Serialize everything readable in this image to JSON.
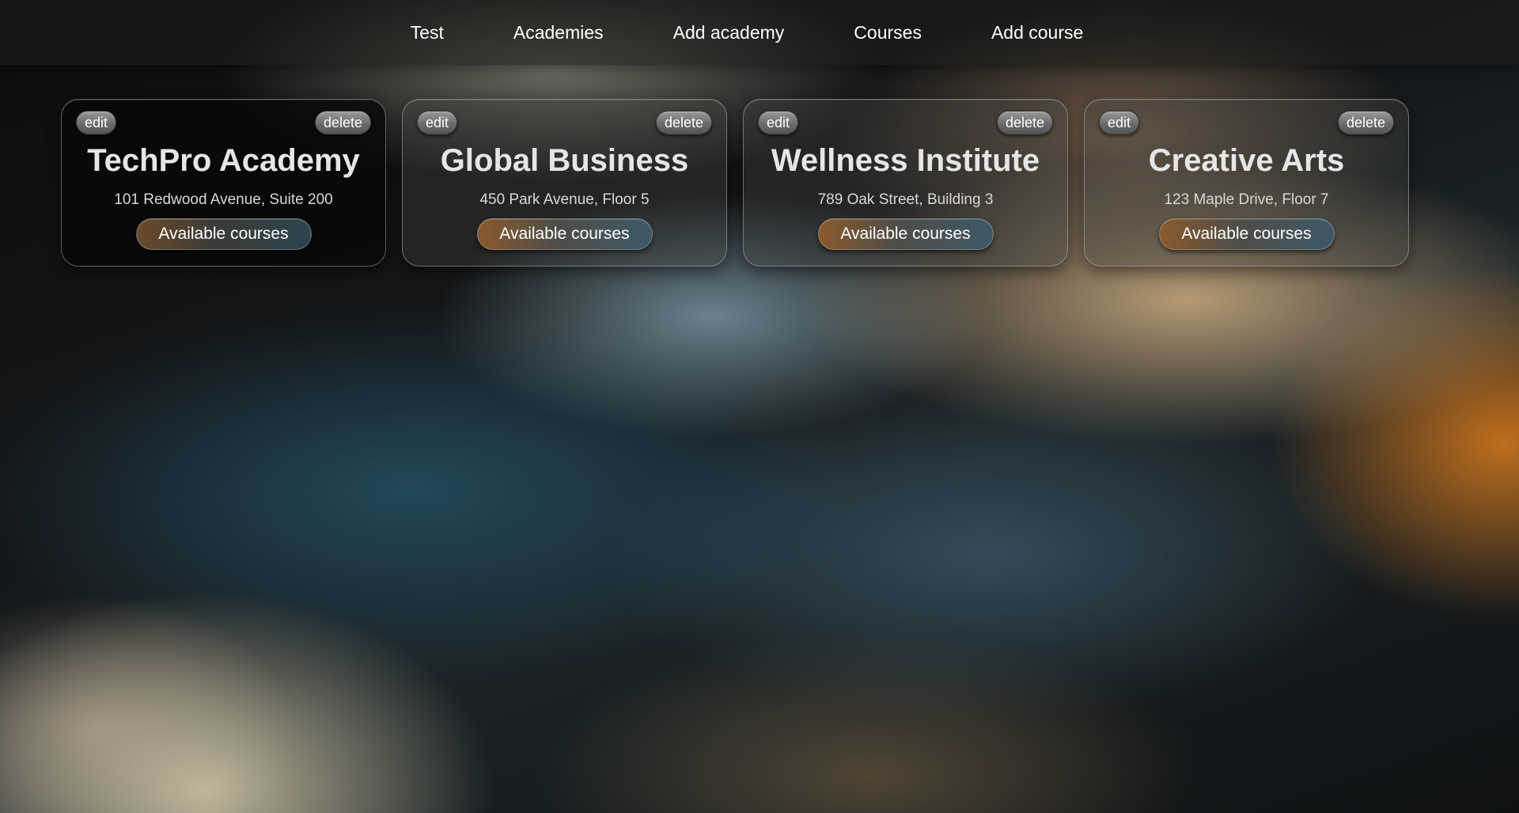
{
  "nav": {
    "items": [
      {
        "label": "Test"
      },
      {
        "label": "Academies"
      },
      {
        "label": "Add academy"
      },
      {
        "label": "Courses"
      },
      {
        "label": "Add course"
      }
    ]
  },
  "academies": [
    {
      "name": "TechPro Academy",
      "address": "101 Redwood Avenue, Suite 200",
      "edit_label": "edit",
      "delete_label": "delete",
      "courses_label": "Available courses"
    },
    {
      "name": "Global Business",
      "address": "450 Park Avenue, Floor 5",
      "edit_label": "edit",
      "delete_label": "delete",
      "courses_label": "Available courses"
    },
    {
      "name": "Wellness Institute",
      "address": "789 Oak Street, Building 3",
      "edit_label": "edit",
      "delete_label": "delete",
      "courses_label": "Available courses"
    },
    {
      "name": "Creative Arts",
      "address": "123 Maple Drive, Floor 7",
      "edit_label": "edit",
      "delete_label": "delete",
      "courses_label": "Available courses"
    }
  ],
  "colors": {
    "accent_warm": "#8a5a2c",
    "accent_cool": "#3d5866",
    "text": "#f2f2f2"
  }
}
